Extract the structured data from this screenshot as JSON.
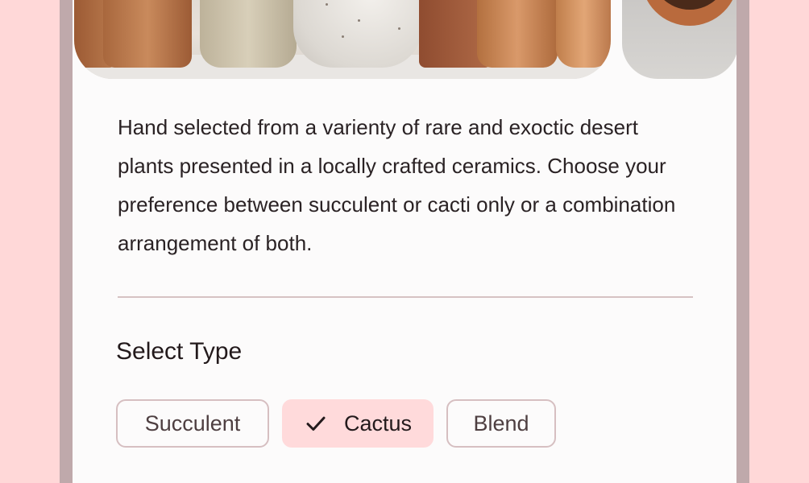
{
  "product": {
    "description": "Hand selected from a varienty of rare and exoctic desert plants presented in a locally crafted ceramics. Choose your preference between succulent or cacti only or a combination arrangement of both."
  },
  "images": [
    {
      "name": "ceramic-pots-photo"
    },
    {
      "name": "terracotta-bowl-photo"
    }
  ],
  "type_selector": {
    "title": "Select Type",
    "options": [
      {
        "label": "Succulent",
        "selected": false
      },
      {
        "label": "Cactus",
        "selected": true
      },
      {
        "label": "Blend",
        "selected": false
      }
    ],
    "selected_icon": "check-icon"
  },
  "colors": {
    "background": "#ffd8d8",
    "surface": "#fcfbfb",
    "selected_chip": "#ffdadb",
    "chip_border": "#d6bfc1",
    "text": "#231a1c"
  }
}
